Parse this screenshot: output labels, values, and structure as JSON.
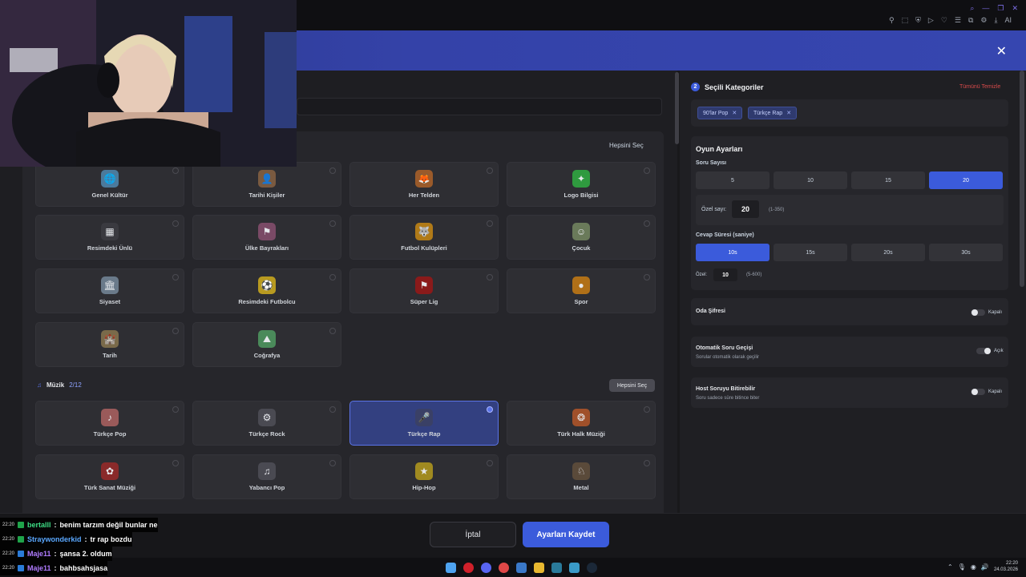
{
  "browser": {
    "toolbar_ai_label": "AI"
  },
  "left": {
    "select_all_label": "Hepsini Seç",
    "general_tiles": [
      {
        "label": "Genel Kültür",
        "icon": "🌐",
        "color": "#4b7a9c"
      },
      {
        "label": "Tarihi Kişiler",
        "icon": "👤",
        "color": "#7a5a40"
      },
      {
        "label": "Her Telden",
        "icon": "🦊",
        "color": "#9a5a2a"
      },
      {
        "label": "Logo Bilgisi",
        "icon": "✦",
        "color": "#2f9a3f"
      },
      {
        "label": "Resimdeki Ünlü",
        "icon": "▦",
        "color": "#3a3a40"
      },
      {
        "label": "Ülke Bayrakları",
        "icon": "⚑",
        "color": "#7a4a66"
      },
      {
        "label": "Futbol Kulüpleri",
        "icon": "🐺",
        "color": "#b07a18"
      },
      {
        "label": "Çocuk",
        "icon": "☺",
        "color": "#6a7a5a"
      },
      {
        "label": "Siyaset",
        "icon": "🏛",
        "color": "#6a7a8a"
      },
      {
        "label": "Resimdeki Futbolcu",
        "icon": "⚽",
        "color": "#b89a20"
      },
      {
        "label": "Süper Lig",
        "icon": "⚑",
        "color": "#8a1a1a"
      },
      {
        "label": "Spor",
        "icon": "●",
        "color": "#b07018"
      },
      {
        "label": "Tarih",
        "icon": "🏰",
        "color": "#7a6a4a"
      },
      {
        "label": "Coğrafya",
        "icon": "⛰",
        "color": "#4a8a5a"
      }
    ],
    "music_section": {
      "title": "Müzik",
      "count": "2/12",
      "select_all_label": "Hepsini Seç",
      "tiles": [
        {
          "label": "Türkçe Pop",
          "icon": "♪",
          "color": "#9a5a5a",
          "selected": false
        },
        {
          "label": "Türkçe Rock",
          "icon": "⚙",
          "color": "#4a4a52",
          "selected": false
        },
        {
          "label": "Türkçe Rap",
          "icon": "🎤",
          "color": "#3a4066",
          "selected": true
        },
        {
          "label": "Türk Halk Müziği",
          "icon": "❂",
          "color": "#a0502a",
          "selected": false
        },
        {
          "label": "Türk Sanat Müziği",
          "icon": "✿",
          "color": "#8a2a2a",
          "selected": false
        },
        {
          "label": "Yabancı Pop",
          "icon": "♫",
          "color": "#4a4a52",
          "selected": false
        },
        {
          "label": "Hip-Hop",
          "icon": "★",
          "color": "#a08a20",
          "selected": false
        },
        {
          "label": "Metal",
          "icon": "♘",
          "color": "#5a4a3a",
          "selected": false
        }
      ]
    }
  },
  "right": {
    "step_number": "2",
    "selected_title": "Seçili Kategoriler",
    "clear_all": "Tümünü Temizle",
    "chips": [
      "90'lar Pop",
      "Türkçe Rap"
    ],
    "game_settings_title": "Oyun Ayarları",
    "question_count": {
      "label": "Soru Sayısı",
      "options": [
        "5",
        "10",
        "15",
        "20"
      ],
      "selected": "20",
      "custom_label": "Özel sayı:",
      "custom_value": "20",
      "custom_range": "(1-350)"
    },
    "answer_time": {
      "label": "Cevap Süresi (saniye)",
      "options": [
        "10s",
        "15s",
        "20s",
        "30s"
      ],
      "selected": "10s",
      "custom_label": "Özel:",
      "custom_value": "10",
      "custom_range": "(5-600)"
    },
    "toggles": [
      {
        "title": "Oda Şifresi",
        "sub": "",
        "state": "Kapalı",
        "on": false
      },
      {
        "title": "Otomatik Soru Geçişi",
        "sub": "Sorular otomatik olarak geçilir",
        "state": "Açık",
        "on": true
      },
      {
        "title": "Host Soruyu Bitirebilir",
        "sub": "Soru sadece süre bitince biter",
        "state": "Kapalı",
        "on": false
      }
    ]
  },
  "footer": {
    "cancel_label": "İptal",
    "save_label": "Ayarları Kaydet"
  },
  "chat": [
    {
      "time": "22:20",
      "user": "bertalll",
      "msg": "benim tarzım değil bunlar ne",
      "user_color": "#3ddc84",
      "badge_color": "#1fa34a"
    },
    {
      "time": "22:20",
      "user": "Straywonderkid",
      "msg": "tr rap bozdu",
      "user_color": "#5aa8ff",
      "badge_color": "#1fa34a"
    },
    {
      "time": "22:20",
      "user": "Maje11",
      "msg": "şansa 2. oldum",
      "user_color": "#b07cff",
      "badge_color": "#2a7bd8"
    },
    {
      "time": "22:20",
      "user": "Maje11",
      "msg": "bahbsahsjasa",
      "user_color": "#b07cff",
      "badge_color": "#2a7bd8"
    }
  ],
  "taskbar": {
    "time": "22:20",
    "date": "24.03.2026"
  },
  "colors": {
    "accent": "#3b5bdb",
    "danger": "#d84b4b"
  }
}
